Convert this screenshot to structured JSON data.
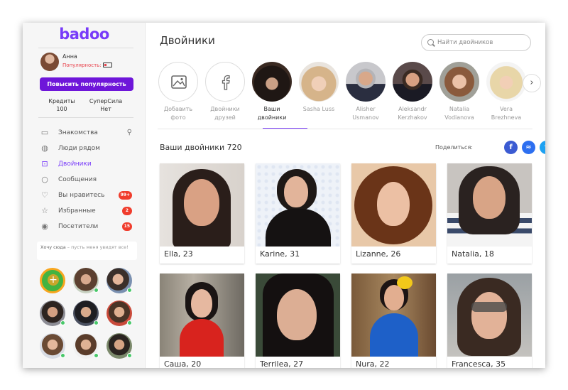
{
  "app": {
    "logo": "badoo"
  },
  "profile": {
    "name": "Анна",
    "popularity_label": "Популярность:",
    "boost_button": "Повысить популярность",
    "credits_label": "Кредиты",
    "credits_value": "100",
    "superpower_label": "СуперСила",
    "superpower_value": "Нет"
  },
  "sidebar": {
    "items": [
      {
        "label": "Знакомства",
        "icon": "cards-icon"
      },
      {
        "label": "Люди рядом",
        "icon": "globe-icon"
      },
      {
        "label": "Двойники",
        "icon": "lookalikes-icon",
        "active": true
      },
      {
        "label": "Сообщения",
        "icon": "chat-icon"
      },
      {
        "label": "Вы нравитесь",
        "icon": "heart-icon",
        "badge": "99+"
      },
      {
        "label": "Избранные",
        "icon": "star-icon",
        "badge": "2"
      },
      {
        "label": "Посетители",
        "icon": "eye-icon",
        "badge": "15"
      }
    ],
    "status": {
      "title": "Хочу сюда",
      "text": " – пусть меня увидят все!"
    }
  },
  "main": {
    "title": "Двойники",
    "search_placeholder": "Найти двойников",
    "categories": [
      {
        "line1": "Добавить",
        "line2": "фото"
      },
      {
        "line1": "Двойники",
        "line2": "друзей"
      },
      {
        "line1": "Ваши",
        "line2": "двойники",
        "active": true
      },
      {
        "line1": "Sasha Luss",
        "line2": ""
      },
      {
        "line1": "Alisher",
        "line2": "Usmanov"
      },
      {
        "line1": "Aleksandr",
        "line2": "Kerzhakov"
      },
      {
        "line1": "Natalia",
        "line2": "Vodianova"
      },
      {
        "line1": "Vera",
        "line2": "Brezhneva"
      }
    ],
    "count_title": "Ваши двойники 720",
    "share_label": "Поделиться:",
    "cards": [
      {
        "name": "Ella, 23"
      },
      {
        "name": "Karine, 31"
      },
      {
        "name": "Lizanne, 26"
      },
      {
        "name": "Natalia, 18"
      },
      {
        "name": "Саша, 20"
      },
      {
        "name": "Terrilea, 27"
      },
      {
        "name": "Nura, 22"
      },
      {
        "name": "Francesca, 35"
      }
    ]
  },
  "colors": {
    "brand": "#783bf9",
    "button": "#6e16d9",
    "badge": "#f03c2c",
    "facebook": "#3b5bd2",
    "messenger": "#2d6ff0",
    "twitter": "#1da1f2"
  }
}
